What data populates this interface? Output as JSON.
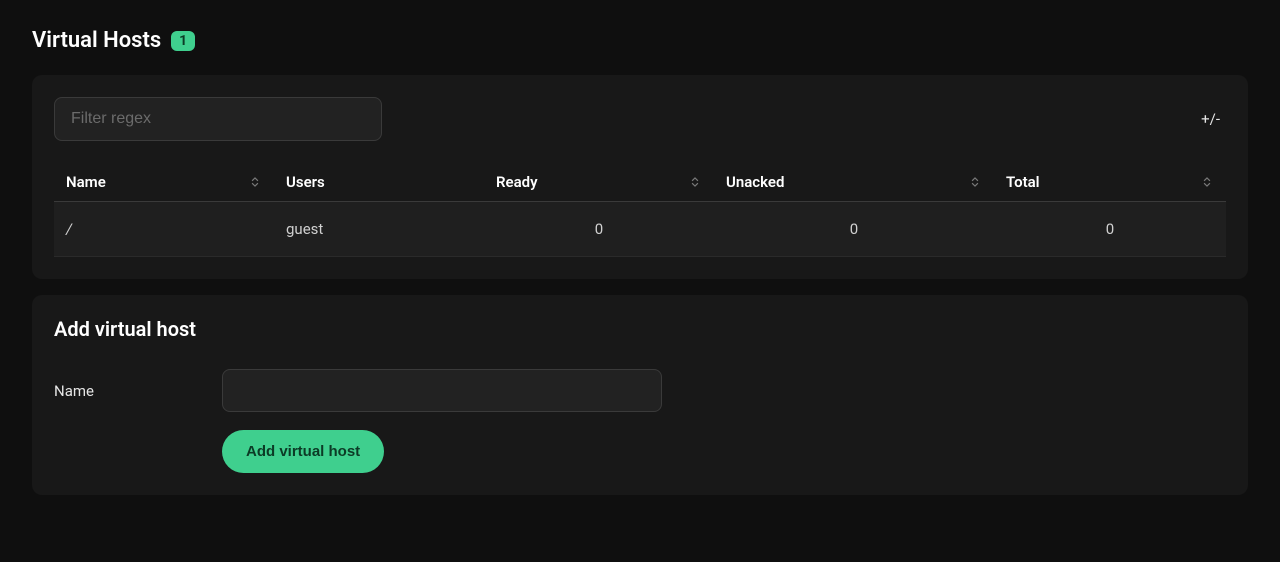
{
  "header": {
    "title": "Virtual Hosts",
    "count": "1"
  },
  "filter": {
    "placeholder": "Filter regex",
    "value": "",
    "plus_minus_label": "+/-"
  },
  "table": {
    "columns": {
      "name": "Name",
      "users": "Users",
      "ready": "Ready",
      "unacked": "Unacked",
      "total": "Total"
    },
    "rows": [
      {
        "name": "/",
        "users": "guest",
        "ready": "0",
        "unacked": "0",
        "total": "0"
      }
    ]
  },
  "add_form": {
    "section_title": "Add virtual host",
    "name_label": "Name",
    "name_value": "",
    "submit_label": "Add virtual host"
  }
}
